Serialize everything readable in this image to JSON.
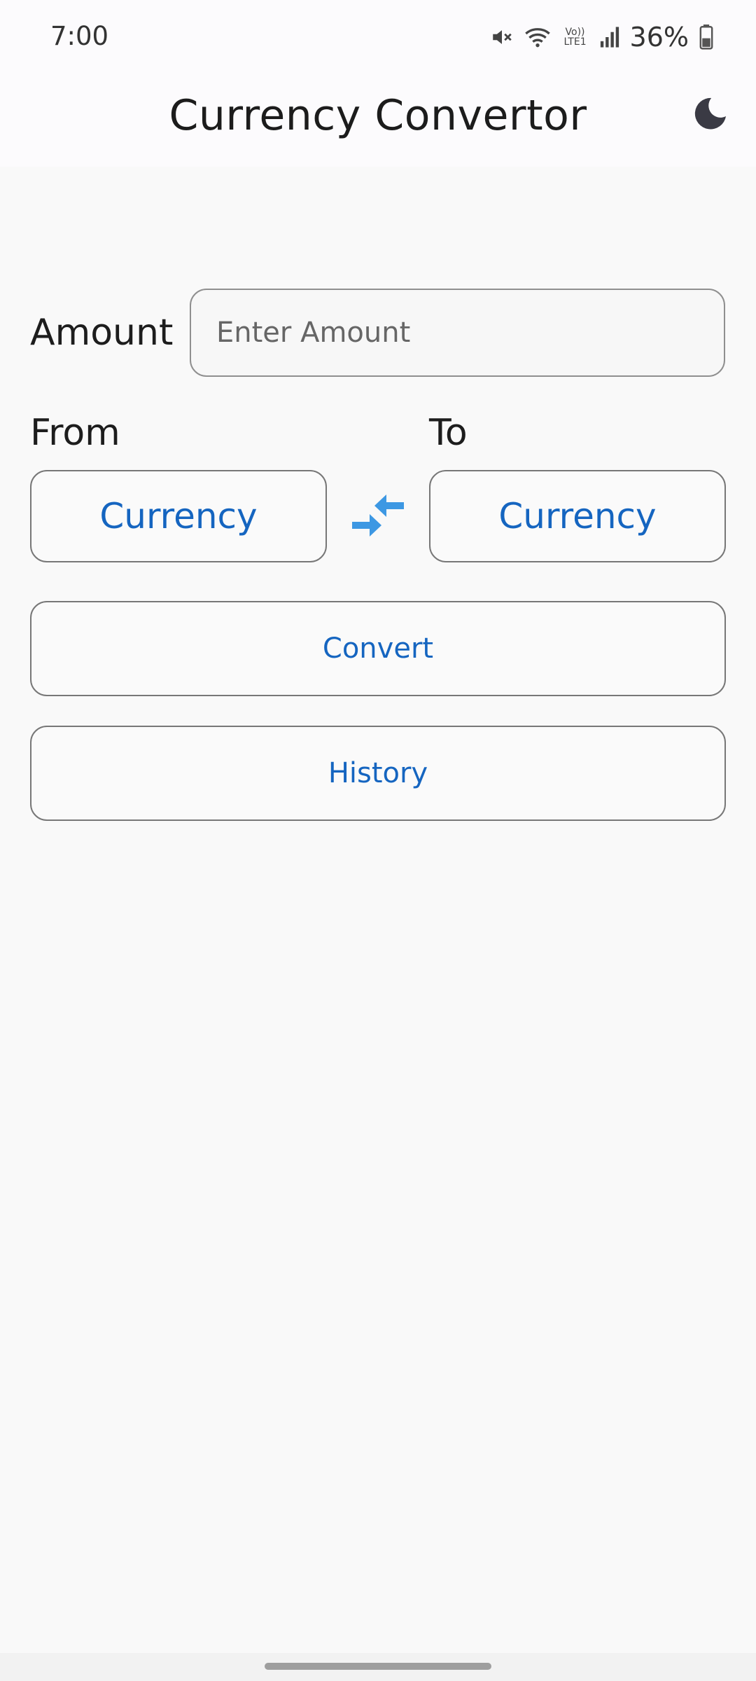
{
  "status_bar": {
    "time": "7:00",
    "battery_percent": "36%",
    "network_label": "Vo)) LTE1",
    "icons": [
      "mute-icon",
      "wifi-icon",
      "volte-icon",
      "signal-icon",
      "battery-icon"
    ]
  },
  "app_bar": {
    "title": "Currency Convertor",
    "theme_toggle_icon": "moon-icon"
  },
  "form": {
    "amount_label": "Amount",
    "amount_placeholder": "Enter Amount",
    "amount_value": "",
    "from_label": "From",
    "to_label": "To",
    "from_currency": "Currency",
    "to_currency": "Currency",
    "swap_icon": "swap-arrows-icon"
  },
  "actions": {
    "convert_label": "Convert",
    "history_label": "History"
  },
  "colors": {
    "accent": "#1565c0",
    "swap_icon": "#3d98e3",
    "background": "#f9f9f9"
  }
}
